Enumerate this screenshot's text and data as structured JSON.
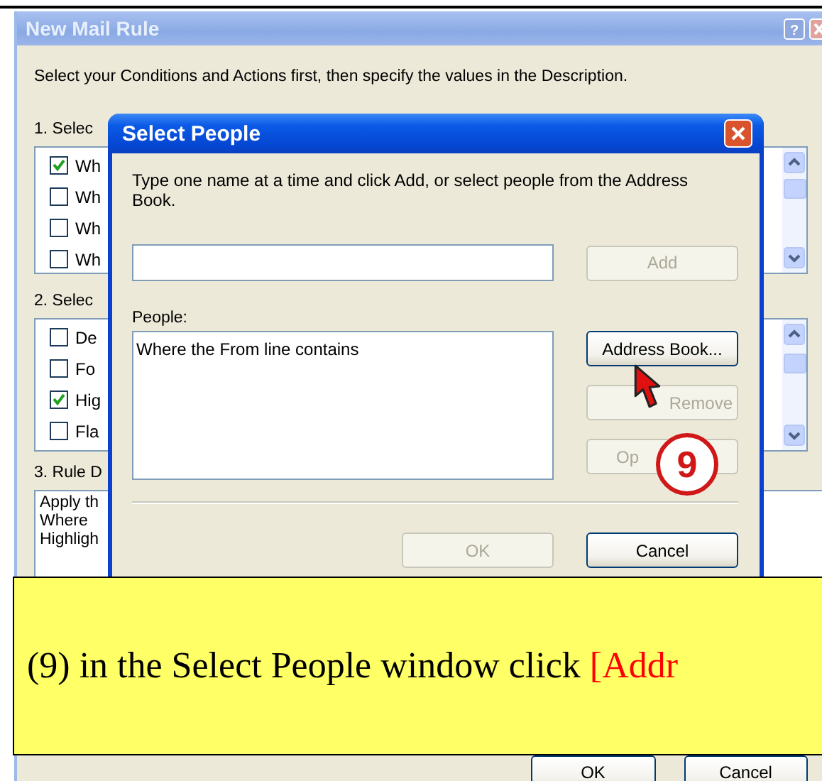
{
  "main_window": {
    "title": "New Mail Rule",
    "help_button": "?",
    "instructions": "Select your Conditions and Actions first, then specify the values in the Description.",
    "sections": [
      {
        "kind": "checklist",
        "label": "1. Selec",
        "items": [
          {
            "label": "Wh",
            "checked": true
          },
          {
            "label": "Wh",
            "checked": false
          },
          {
            "label": "Wh",
            "checked": false
          },
          {
            "label": "Wh",
            "checked": false
          }
        ]
      },
      {
        "kind": "checklist",
        "label": "2. Selec",
        "items": [
          {
            "label": "De",
            "checked": false
          },
          {
            "label": "Fo",
            "checked": false
          },
          {
            "label": "Hig",
            "checked": true
          },
          {
            "label": "Fla",
            "checked": false
          }
        ]
      },
      {
        "kind": "text",
        "label": "3. Rule D",
        "lines": [
          "Apply th",
          "Where",
          "Highligh"
        ]
      }
    ],
    "buttons": [
      {
        "label": "OK"
      },
      {
        "label": "Cancel"
      }
    ]
  },
  "dialog": {
    "title": "Select People",
    "instructions": "Type one name at a time and click Add, or select people from the Address Book.",
    "add_button": {
      "label": "Add",
      "disabled": true
    },
    "people_label": "People:",
    "people": [
      "Where the From line contains"
    ],
    "side_buttons": [
      {
        "label": "Address Book...",
        "disabled": false
      },
      {
        "label": "Remove",
        "disabled": true
      },
      {
        "label": "Op",
        "disabled": true
      }
    ],
    "footer_buttons": [
      {
        "label": "OK",
        "disabled": true
      },
      {
        "label": "Cancel",
        "disabled": false
      }
    ]
  },
  "callout": {
    "step": "9",
    "text": "(9) in the Select People window click ",
    "highlight": "[Addr"
  }
}
